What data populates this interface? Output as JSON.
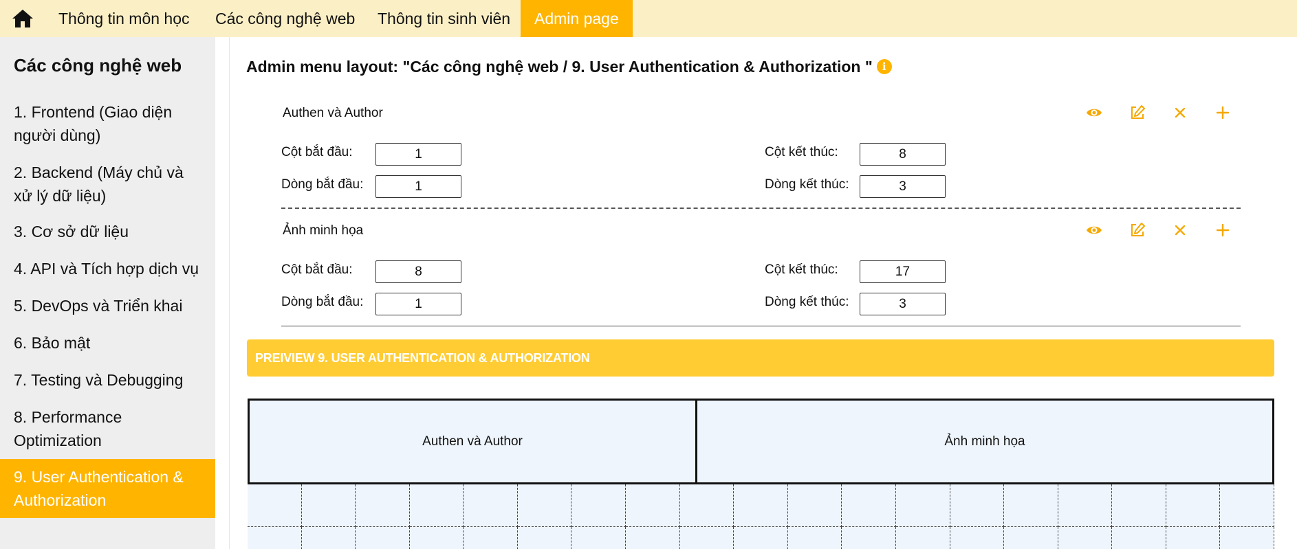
{
  "nav": {
    "home_icon": "home-icon",
    "tabs": [
      {
        "label": "Thông tin môn học",
        "active": false
      },
      {
        "label": "Các công nghệ web",
        "active": false
      },
      {
        "label": "Thông tin sinh viên",
        "active": false
      },
      {
        "label": "Admin page",
        "active": true
      }
    ]
  },
  "sidebar": {
    "title": "Các công nghệ web",
    "items": [
      {
        "label": "1. Frontend (Giao diện người dùng)",
        "active": false
      },
      {
        "label": "2. Backend (Máy chủ và xử lý dữ liệu)",
        "active": false
      },
      {
        "label": "3. Cơ sở dữ liệu",
        "active": false
      },
      {
        "label": "4. API và Tích hợp dịch vụ",
        "active": false
      },
      {
        "label": "5. DevOps và Triển khai",
        "active": false
      },
      {
        "label": "6. Bảo mật",
        "active": false
      },
      {
        "label": "7. Testing và Debugging",
        "active": false
      },
      {
        "label": "8. Performance Optimization",
        "active": false
      },
      {
        "label": "9. User Authentication & Authorization",
        "active": true
      }
    ]
  },
  "main": {
    "title": "Admin menu layout: \"Các công nghệ web / 9. User Authentication & Authorization \"",
    "info_icon": "info-icon",
    "labels": {
      "col_start": "Cột bắt đầu:",
      "col_end": "Cột kết thúc:",
      "row_start": "Dòng bắt đầu:",
      "row_end": "Dòng kết thúc:"
    },
    "actions": [
      "eye-icon",
      "edit-icon",
      "close-icon",
      "plus-icon"
    ],
    "blocks": [
      {
        "name": "Authen và Author",
        "col_start": "1",
        "col_end": "8",
        "row_start": "1",
        "row_end": "3"
      },
      {
        "name": "Ảnh minh họa",
        "col_start": "8",
        "col_end": "17",
        "row_start": "1",
        "row_end": "3"
      }
    ],
    "preview_title": "PREIVIEW 9. USER AUTHENTICATION & AUTHORIZATION",
    "preview_blocks": [
      "Authen và Author",
      "Ảnh minh họa"
    ]
  },
  "colors": {
    "accent": "#ffb400",
    "nav_bg": "#fbefc6",
    "preview_bar": "#ffcc33",
    "grid_bg": "#eef5fd"
  }
}
